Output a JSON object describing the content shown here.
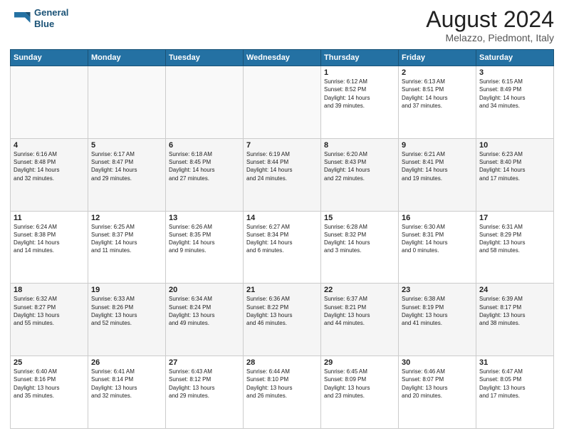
{
  "logo": {
    "line1": "General",
    "line2": "Blue"
  },
  "title": "August 2024",
  "location": "Melazzo, Piedmont, Italy",
  "days_header": [
    "Sunday",
    "Monday",
    "Tuesday",
    "Wednesday",
    "Thursday",
    "Friday",
    "Saturday"
  ],
  "weeks": [
    [
      {
        "day": "",
        "info": ""
      },
      {
        "day": "",
        "info": ""
      },
      {
        "day": "",
        "info": ""
      },
      {
        "day": "",
        "info": ""
      },
      {
        "day": "1",
        "info": "Sunrise: 6:12 AM\nSunset: 8:52 PM\nDaylight: 14 hours\nand 39 minutes."
      },
      {
        "day": "2",
        "info": "Sunrise: 6:13 AM\nSunset: 8:51 PM\nDaylight: 14 hours\nand 37 minutes."
      },
      {
        "day": "3",
        "info": "Sunrise: 6:15 AM\nSunset: 8:49 PM\nDaylight: 14 hours\nand 34 minutes."
      }
    ],
    [
      {
        "day": "4",
        "info": "Sunrise: 6:16 AM\nSunset: 8:48 PM\nDaylight: 14 hours\nand 32 minutes."
      },
      {
        "day": "5",
        "info": "Sunrise: 6:17 AM\nSunset: 8:47 PM\nDaylight: 14 hours\nand 29 minutes."
      },
      {
        "day": "6",
        "info": "Sunrise: 6:18 AM\nSunset: 8:45 PM\nDaylight: 14 hours\nand 27 minutes."
      },
      {
        "day": "7",
        "info": "Sunrise: 6:19 AM\nSunset: 8:44 PM\nDaylight: 14 hours\nand 24 minutes."
      },
      {
        "day": "8",
        "info": "Sunrise: 6:20 AM\nSunset: 8:43 PM\nDaylight: 14 hours\nand 22 minutes."
      },
      {
        "day": "9",
        "info": "Sunrise: 6:21 AM\nSunset: 8:41 PM\nDaylight: 14 hours\nand 19 minutes."
      },
      {
        "day": "10",
        "info": "Sunrise: 6:23 AM\nSunset: 8:40 PM\nDaylight: 14 hours\nand 17 minutes."
      }
    ],
    [
      {
        "day": "11",
        "info": "Sunrise: 6:24 AM\nSunset: 8:38 PM\nDaylight: 14 hours\nand 14 minutes."
      },
      {
        "day": "12",
        "info": "Sunrise: 6:25 AM\nSunset: 8:37 PM\nDaylight: 14 hours\nand 11 minutes."
      },
      {
        "day": "13",
        "info": "Sunrise: 6:26 AM\nSunset: 8:35 PM\nDaylight: 14 hours\nand 9 minutes."
      },
      {
        "day": "14",
        "info": "Sunrise: 6:27 AM\nSunset: 8:34 PM\nDaylight: 14 hours\nand 6 minutes."
      },
      {
        "day": "15",
        "info": "Sunrise: 6:28 AM\nSunset: 8:32 PM\nDaylight: 14 hours\nand 3 minutes."
      },
      {
        "day": "16",
        "info": "Sunrise: 6:30 AM\nSunset: 8:31 PM\nDaylight: 14 hours\nand 0 minutes."
      },
      {
        "day": "17",
        "info": "Sunrise: 6:31 AM\nSunset: 8:29 PM\nDaylight: 13 hours\nand 58 minutes."
      }
    ],
    [
      {
        "day": "18",
        "info": "Sunrise: 6:32 AM\nSunset: 8:27 PM\nDaylight: 13 hours\nand 55 minutes."
      },
      {
        "day": "19",
        "info": "Sunrise: 6:33 AM\nSunset: 8:26 PM\nDaylight: 13 hours\nand 52 minutes."
      },
      {
        "day": "20",
        "info": "Sunrise: 6:34 AM\nSunset: 8:24 PM\nDaylight: 13 hours\nand 49 minutes."
      },
      {
        "day": "21",
        "info": "Sunrise: 6:36 AM\nSunset: 8:22 PM\nDaylight: 13 hours\nand 46 minutes."
      },
      {
        "day": "22",
        "info": "Sunrise: 6:37 AM\nSunset: 8:21 PM\nDaylight: 13 hours\nand 44 minutes."
      },
      {
        "day": "23",
        "info": "Sunrise: 6:38 AM\nSunset: 8:19 PM\nDaylight: 13 hours\nand 41 minutes."
      },
      {
        "day": "24",
        "info": "Sunrise: 6:39 AM\nSunset: 8:17 PM\nDaylight: 13 hours\nand 38 minutes."
      }
    ],
    [
      {
        "day": "25",
        "info": "Sunrise: 6:40 AM\nSunset: 8:16 PM\nDaylight: 13 hours\nand 35 minutes."
      },
      {
        "day": "26",
        "info": "Sunrise: 6:41 AM\nSunset: 8:14 PM\nDaylight: 13 hours\nand 32 minutes."
      },
      {
        "day": "27",
        "info": "Sunrise: 6:43 AM\nSunset: 8:12 PM\nDaylight: 13 hours\nand 29 minutes."
      },
      {
        "day": "28",
        "info": "Sunrise: 6:44 AM\nSunset: 8:10 PM\nDaylight: 13 hours\nand 26 minutes."
      },
      {
        "day": "29",
        "info": "Sunrise: 6:45 AM\nSunset: 8:09 PM\nDaylight: 13 hours\nand 23 minutes."
      },
      {
        "day": "30",
        "info": "Sunrise: 6:46 AM\nSunset: 8:07 PM\nDaylight: 13 hours\nand 20 minutes."
      },
      {
        "day": "31",
        "info": "Sunrise: 6:47 AM\nSunset: 8:05 PM\nDaylight: 13 hours\nand 17 minutes."
      }
    ]
  ]
}
